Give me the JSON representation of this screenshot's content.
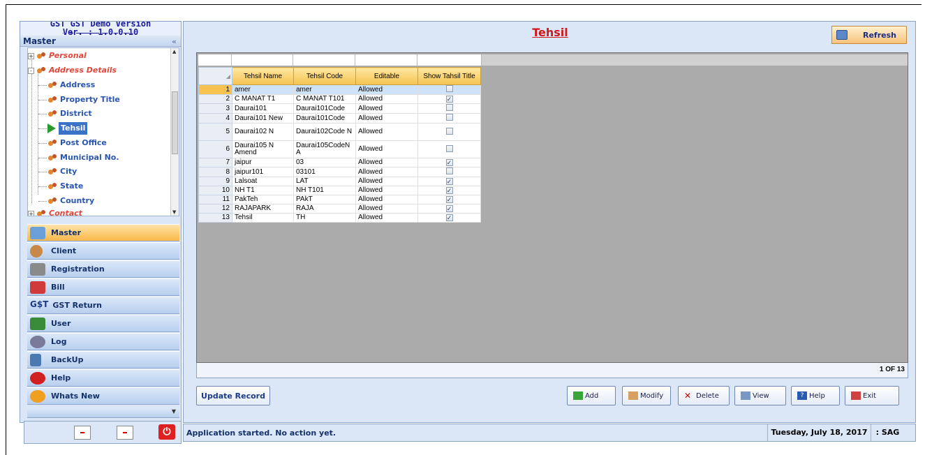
{
  "app": {
    "version_top": "Ver. : 1.0.0.10",
    "version_hidden": "GST GST Demo Version"
  },
  "sidebar": {
    "header": "Master",
    "collapse_glyph": "«",
    "tree": [
      {
        "label": "Personal",
        "type": "category",
        "expander": "+"
      },
      {
        "label": "Address Details",
        "type": "category",
        "expander": "-"
      },
      {
        "label": "Address",
        "type": "child"
      },
      {
        "label": "Property Title",
        "type": "child"
      },
      {
        "label": "District",
        "type": "child"
      },
      {
        "label": "Tehsil",
        "type": "child",
        "selected": true
      },
      {
        "label": "Post Office",
        "type": "child"
      },
      {
        "label": "Municipal No.",
        "type": "child"
      },
      {
        "label": "City",
        "type": "child"
      },
      {
        "label": "State",
        "type": "child"
      },
      {
        "label": "Country",
        "type": "child"
      },
      {
        "label": "Contact",
        "type": "category",
        "expander": "+"
      }
    ],
    "nav": [
      {
        "label": "Master",
        "icon": "master-icon",
        "active": true,
        "color": "#6aa0d8"
      },
      {
        "label": "Client",
        "icon": "client-icon",
        "color": "#c8884a"
      },
      {
        "label": "Registration",
        "icon": "registration-icon",
        "color": "#8a8a8a"
      },
      {
        "label": "Bill",
        "icon": "bill-icon",
        "color": "#d03a3a"
      },
      {
        "label": "GST Return",
        "icon": "gst-icon",
        "color": "#1b3a8a"
      },
      {
        "label": "User",
        "icon": "user-icon",
        "color": "#3a8a3a"
      },
      {
        "label": "Log",
        "icon": "log-icon",
        "color": "#7a7a9a"
      },
      {
        "label": "BackUp",
        "icon": "backup-icon",
        "color": "#4a7ab0"
      },
      {
        "label": "Help",
        "icon": "help-icon",
        "color": "#d02020"
      },
      {
        "label": "Whats New",
        "icon": "whats-new-icon",
        "color": "#f0a020"
      }
    ]
  },
  "main": {
    "title": "Tehsil",
    "refresh_label": "Refresh",
    "table": {
      "columns": [
        "Tehsil Name",
        "Tehsil Code",
        "Editable",
        "Show Tahsil Title"
      ],
      "rows": [
        {
          "n": "1",
          "name": "amer",
          "code": "amer",
          "editable": "Allowed",
          "show": false,
          "selected": true
        },
        {
          "n": "2",
          "name": "C MANAT T1",
          "code": "C MANAT T101",
          "editable": "Allowed",
          "show": true
        },
        {
          "n": "3",
          "name": "Daurai101",
          "code": "Daurai101Code",
          "editable": "Allowed",
          "show": false
        },
        {
          "n": "4",
          "name": "Daurai101 New",
          "code": "Daurai101Code",
          "editable": "Allowed",
          "show": false
        },
        {
          "n": "5",
          "name": "Daurai102 N",
          "code": "Daurai102Code N",
          "editable": "Allowed",
          "show": false,
          "tall": true
        },
        {
          "n": "6",
          "name": "Daurai105 N Amend",
          "code": "Daurai105CodeN A",
          "editable": "Allowed",
          "show": false,
          "tall": true
        },
        {
          "n": "7",
          "name": "jaipur",
          "code": "03",
          "editable": "Allowed",
          "show": true
        },
        {
          "n": "8",
          "name": "jaipur101",
          "code": "03101",
          "editable": "Allowed",
          "show": false
        },
        {
          "n": "9",
          "name": "Lalsoat",
          "code": "LAT",
          "editable": "Allowed",
          "show": true
        },
        {
          "n": "10",
          "name": "NH T1",
          "code": "NH T101",
          "editable": "Allowed",
          "show": true
        },
        {
          "n": "11",
          "name": "PakTeh",
          "code": "PAkT",
          "editable": "Allowed",
          "show": true
        },
        {
          "n": "12",
          "name": "RAJAPARK",
          "code": "RAJA",
          "editable": "Allowed",
          "show": true
        },
        {
          "n": "13",
          "name": "Tehsil",
          "code": "TH",
          "editable": "Allowed",
          "show": true
        }
      ]
    },
    "pager": "1 OF 13",
    "buttons": {
      "update": "Update Record",
      "add": "Add",
      "modify": "Modify",
      "delete": "Delete",
      "view": "View",
      "help": "Help",
      "exit": "Exit"
    }
  },
  "status": {
    "message": "Application started. No action yet.",
    "date": "Tuesday, July 18, 2017",
    "user": ": SAG"
  }
}
